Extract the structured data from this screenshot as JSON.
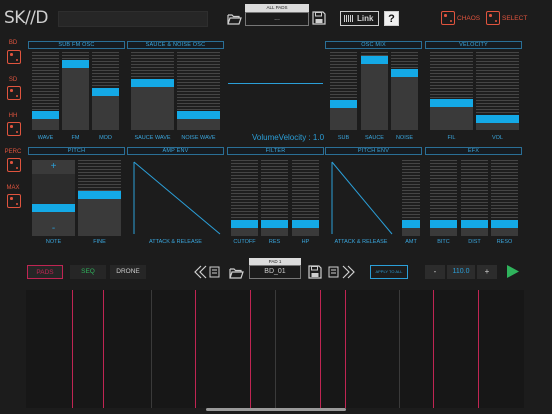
{
  "header": {
    "logo": "SK//D",
    "pads_caption": "ALL PADS",
    "pads_value": "...",
    "link_label": "Link",
    "help_label": "?",
    "chaos_label": "CHAOS",
    "select_label": "SELECT"
  },
  "side": {
    "items": [
      {
        "label": "BD"
      },
      {
        "label": "SD"
      },
      {
        "label": "HH"
      },
      {
        "label": "PERC"
      },
      {
        "label": "MAX"
      }
    ]
  },
  "panels": {
    "sub_fm_osc": {
      "title": "SUB FM OSC",
      "labels": [
        "WAVE",
        "FM",
        "MOD"
      ]
    },
    "sauce_noise_osc": {
      "title": "SAUCE & NOISE OSC",
      "labels": [
        "SAUCE WAVE",
        "NOISE WAVE"
      ]
    },
    "osc_mix": {
      "title": "OSC MIX",
      "labels": [
        "SUB",
        "SAUCE",
        "NOISE"
      ]
    },
    "velocity": {
      "title": "VELOCITY",
      "labels": [
        "FIL",
        "VOL"
      ]
    },
    "status_text": "VolumeVelocity : 1.0",
    "pitch": {
      "title": "PITCH",
      "plus": "+",
      "minus": "-",
      "labels": [
        "NOTE",
        "FINE"
      ]
    },
    "amp_env": {
      "title": "AMP ENV",
      "label": "ATTACK & RELEASE"
    },
    "filter": {
      "title": "FILTER",
      "labels": [
        "CUTOFF",
        "RES",
        "HP"
      ]
    },
    "pitch_env": {
      "title": "PITCH ENV",
      "labels": [
        "ATTACK & RELEASE",
        "AMT"
      ]
    },
    "efx": {
      "title": "EFX",
      "labels": [
        "BITC",
        "DIST",
        "RESO"
      ]
    }
  },
  "slider_levels": {
    "wave": 0.16,
    "fm": 0.88,
    "mod": 0.49,
    "sauce_wave": 0.61,
    "noise_wave": 0.16,
    "sub": 0.32,
    "sauce": 0.95,
    "noise": 0.76,
    "fil": 0.33,
    "vol": 0.1,
    "note": 0.25,
    "fine": 0.55,
    "cutoff": 0.12,
    "res": 0.12,
    "hp": 0.12,
    "amt": 0.12,
    "bitc": 0.12,
    "dist": 0.12,
    "reso": 0.12
  },
  "transport": {
    "tabs": [
      "PADS",
      "SEQ",
      "DRONE"
    ],
    "pad_caption": "PAD 1",
    "pad_name": "BD_01",
    "apply_label": "APPLY TO ALL",
    "minus": "-",
    "tempo": "110.0",
    "plus": "+"
  },
  "colors": {
    "accent": "#14a9e6",
    "chaos": "#e0543e",
    "pads_tab": "#c02553",
    "seq_tab": "#2fb35c",
    "play": "#2fb35c"
  }
}
